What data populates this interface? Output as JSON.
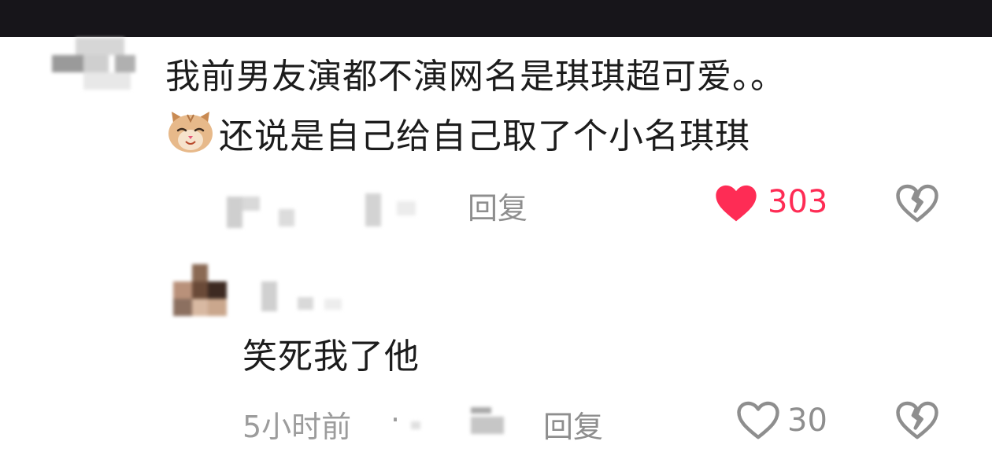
{
  "colors": {
    "top_bar": "#17151a",
    "text_primary": "#1c1c1c",
    "text_meta": "#8e8e8e",
    "like_active": "#fe2c55"
  },
  "comment": {
    "text_line1": "我前男友演都不演网名是琪琪超可爱。。",
    "text_line2": "还说是自己给自己取了个小名琪琪",
    "emoji": "cat-face-emoji",
    "reply_label": "回复",
    "like_count": "303",
    "liked": true
  },
  "reply": {
    "text": "笑死我了他",
    "time": "5小时前",
    "separator": "·",
    "reply_label": "回复",
    "like_count": "30",
    "liked": false
  }
}
